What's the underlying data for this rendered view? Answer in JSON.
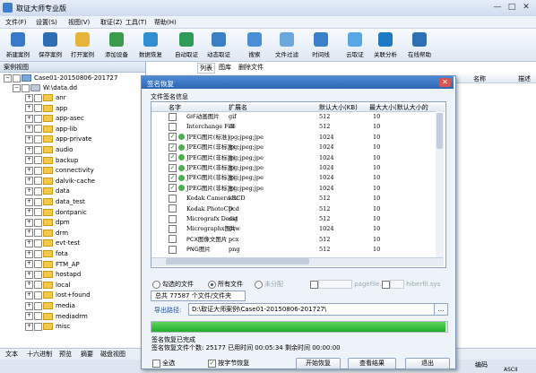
{
  "window": {
    "title": "取证大师专业版",
    "min": "—",
    "max": "□",
    "close": "✕"
  },
  "menu": [
    "文件(F)",
    "设置(S)",
    "视图(V)",
    "取证(Z)",
    "工具(T)",
    "帮助(H)"
  ],
  "toolbar": [
    {
      "label": "新建案例",
      "icon": "new-case-icon",
      "color": "#3a78c8"
    },
    {
      "label": "保存案例",
      "icon": "save-case-icon",
      "color": "#2e6db3"
    },
    {
      "label": "打开案例",
      "icon": "open-case-icon",
      "color": "#e7b43b"
    },
    {
      "label": "添加设备",
      "icon": "add-device-icon",
      "color": "#3b9b4a"
    },
    {
      "label": "数据恢复",
      "icon": "data-recovery-icon",
      "color": "#2f8fd0"
    },
    {
      "label": "自动取证",
      "icon": "auto-forensics-icon",
      "color": "#2f9a58"
    },
    {
      "label": "动态取证",
      "icon": "dynamic-forensics-icon",
      "color": "#3b7fc6"
    },
    {
      "label": "搜索",
      "icon": "search-icon",
      "color": "#4d8fd4"
    },
    {
      "label": "文件过滤",
      "icon": "file-filter-icon",
      "color": "#6aa7de"
    },
    {
      "label": "时间线",
      "icon": "timeline-icon",
      "color": "#3a7fc9"
    },
    {
      "label": "云取证",
      "icon": "cloud-forensics-icon",
      "color": "#58a6e4"
    },
    {
      "label": "关联分析",
      "icon": "correlation-icon",
      "color": "#1f7ac4"
    },
    {
      "label": "在线帮助",
      "icon": "online-help-icon",
      "color": "#2f6fb6"
    }
  ],
  "left": {
    "header": "案例视图",
    "case": "Case01-20150806-201727",
    "drive": "W:\\data.dd",
    "folders": [
      "anr",
      "app",
      "app-asec",
      "app-lib",
      "app-private",
      "audio",
      "backup",
      "connectivity",
      "dalvik-cache",
      "data",
      "data_test",
      "dontpanic",
      "dpm",
      "drm",
      "evt-test",
      "fota",
      "FTM_AP",
      "hostapd",
      "local",
      "lost+found",
      "media",
      "mediadrm",
      "misc"
    ]
  },
  "right": {
    "tabs": [
      "列表",
      "图库",
      "删除文件"
    ],
    "col_name": "名称",
    "col_desc": "描述"
  },
  "bottom_tabs": [
    "文本",
    "十六进制",
    "预览",
    "摘要",
    "磁盘视图"
  ],
  "status": {
    "encoding": "编码",
    "charset": "ASCII"
  },
  "dialog": {
    "title": "签名恢复",
    "section": "文件签名信息",
    "headers": [
      "名字",
      "扩展名",
      "默认大小(KB)",
      "最大大小(默认大小的"
    ],
    "rows": [
      {
        "checked": false,
        "name": "GIF动画图片",
        "ext": "gif",
        "def": "512",
        "max": "10",
        "serif": false
      },
      {
        "checked": false,
        "name": "Interchange File",
        "ext": "iff",
        "def": "512",
        "max": "10",
        "serif": true
      },
      {
        "checked": true,
        "name": "JPEG图片(标准)",
        "ext": "jpg;jpeg;jpe",
        "def": "1024",
        "max": "10",
        "serif": true
      },
      {
        "checked": true,
        "name": "JPEG图片(非标准)",
        "ext": "jpg;jpeg;jpe",
        "def": "1024",
        "max": "10",
        "serif": true
      },
      {
        "checked": true,
        "name": "JPEG图片(非标准)",
        "ext": "jpg;jpeg;jpe",
        "def": "1024",
        "max": "10",
        "serif": true
      },
      {
        "checked": true,
        "name": "JPEG图片(非标准)",
        "ext": "jpg;jpeg;jpe",
        "def": "1024",
        "max": "10",
        "serif": true
      },
      {
        "checked": true,
        "name": "JPEG图片(非标准)",
        "ext": "jpg;jpeg;jpe",
        "def": "1024",
        "max": "10",
        "serif": true
      },
      {
        "checked": true,
        "name": "JPEG图片(非标准)",
        "ext": "jpg;jpeg;jpe",
        "def": "1024",
        "max": "10",
        "serif": true
      },
      {
        "checked": false,
        "name": "Kodak Camera RCD",
        "ext": "kdc",
        "def": "512",
        "max": "10",
        "serif": true
      },
      {
        "checked": false,
        "name": "Kodak PhotoCD",
        "ext": "pcd",
        "def": "512",
        "max": "10",
        "serif": true
      },
      {
        "checked": false,
        "name": "Micrografx Desig",
        "ext": "dsf",
        "def": "512",
        "max": "10",
        "serif": true
      },
      {
        "checked": false,
        "name": "Micrographx图片",
        "ext": "drw",
        "def": "1024",
        "max": "10",
        "serif": true
      },
      {
        "checked": false,
        "name": "PCX图像文图片",
        "ext": "pcx",
        "def": "512",
        "max": "10",
        "serif": false
      },
      {
        "checked": false,
        "name": "PNG图片",
        "ext": "png",
        "def": "512",
        "max": "10",
        "serif": false
      }
    ],
    "options": {
      "checked": "勾选的文件",
      "all": "所有文件",
      "unalloc": "未分配",
      "pagefile": "pagefile.sys",
      "hiberfil": "hiberfil.sys"
    },
    "total": "总共 77587 个文件/文件夹",
    "path_label": "导出路径:",
    "path_value": "D:\\取证大师案例\\Case01-20150806-201727\\",
    "browse": "...",
    "progress": 1.0,
    "status1": "签名恢复已完成",
    "status2": "签名恢复文件个数: 25177   已用时间 00:05:34   剩余时间 00:00:00",
    "select_all": "全选",
    "byte_align": "按字节恢复",
    "start": "开始恢复",
    "view": "查看结果",
    "exit": "退出"
  }
}
